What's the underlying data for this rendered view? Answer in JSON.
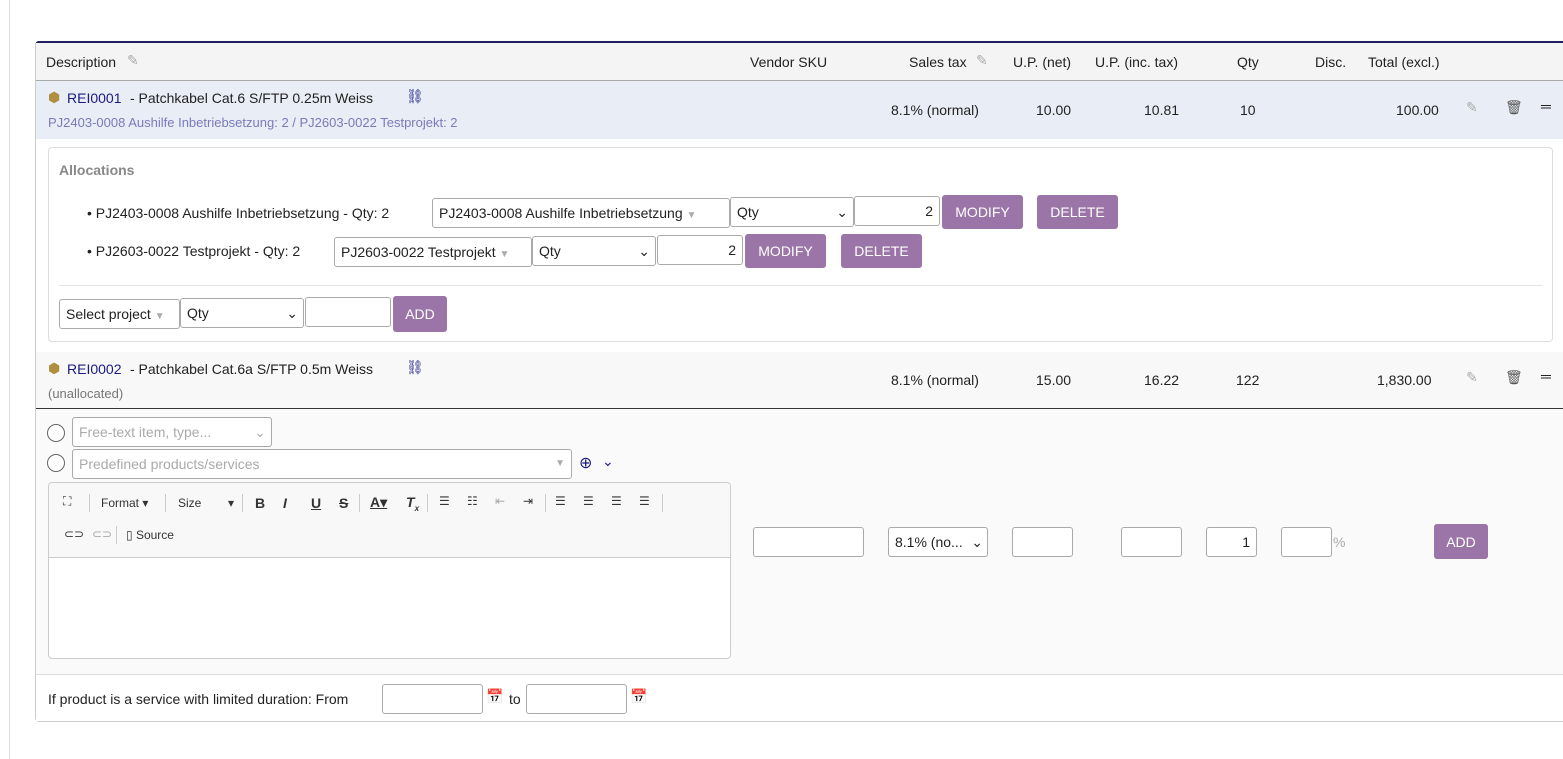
{
  "header": {
    "description": "Description",
    "vendor_sku": "Vendor SKU",
    "sales_tax": "Sales tax",
    "up_net": "U.P. (net)",
    "up_inc": "U.P. (inc. tax)",
    "qty": "Qty",
    "disc": "Disc.",
    "total": "Total (excl.)"
  },
  "lines": [
    {
      "ref": "REI0001",
      "label": " - Patchkabel Cat.6 S/FTP 0.25m Weiss",
      "sub": "PJ2403-0008 Aushilfe Inbetriebsetzung: 2 / PJ2603-0022 Testprojekt: 2",
      "tax": "8.1% (normal)",
      "up_net": "10.00",
      "up_inc": "10.81",
      "qty": "10",
      "total": "100.00"
    },
    {
      "ref": "REI0002",
      "label": " - Patchkabel Cat.6a S/FTP 0.5m Weiss",
      "sub": "(unallocated)",
      "tax": "8.1% (normal)",
      "up_net": "15.00",
      "up_inc": "16.22",
      "qty": "122",
      "total": "1,830.00"
    }
  ],
  "allocations": {
    "title": "Allocations",
    "items": [
      {
        "text": "PJ2403-0008 Aushilfe Inbetriebsetzung - Qty: 2",
        "project": "PJ2403-0008 Aushilfe Inbetriebsetzung",
        "qty_mode": "Qty",
        "qty": "2",
        "modify": "MODIFY",
        "delete": "DELETE"
      },
      {
        "text": "PJ2603-0022 Testprojekt - Qty: 2",
        "project": "PJ2603-0022 Testprojekt",
        "qty_mode": "Qty",
        "qty": "2",
        "modify": "MODIFY",
        "delete": "DELETE"
      }
    ],
    "new_project": "Select project",
    "new_qty_mode": "Qty",
    "add": "ADD"
  },
  "add_line": {
    "free_text_placeholder": "Free-text item, type...",
    "predefined_placeholder": "Predefined products/services",
    "toolbar": {
      "format": "Format",
      "size": "Size",
      "source": "Source"
    },
    "tax": "8.1% (no...",
    "qty": "1",
    "percent": "%",
    "add": "ADD"
  },
  "dates": {
    "label": "If product is a service with limited duration: From",
    "to": "to"
  }
}
